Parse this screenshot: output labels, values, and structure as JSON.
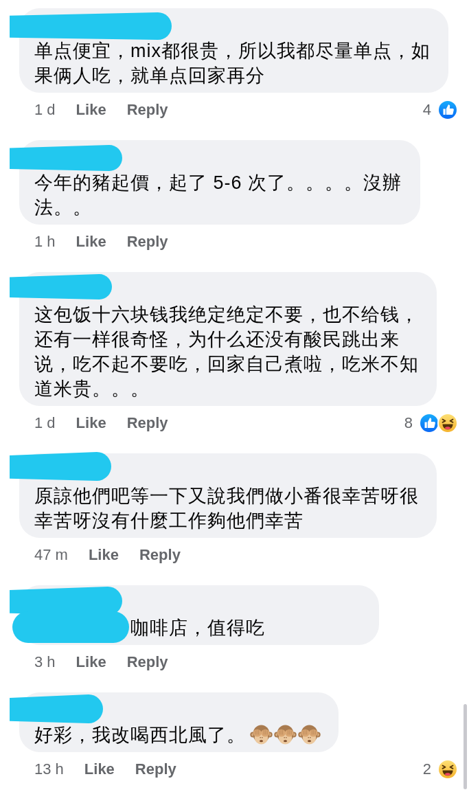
{
  "comments": [
    {
      "kind": "plain",
      "text": "单点便宜，mix都很贵，所以我都尽量单点，如果俩人吃，就单点回家再分",
      "time": "1 d",
      "like": "Like",
      "reply": "Reply",
      "reaction_count": "4",
      "reactions": [
        {
          "kind": "like"
        }
      ]
    },
    {
      "kind": "plain",
      "text": "今年的豬起價，起了 5-6 次了。。。。沒辦法。。",
      "time": "1 h",
      "like": "Like",
      "reply": "Reply"
    },
    {
      "kind": "plain",
      "text": "这包饭十六块钱我绝定绝定不要，也不给钱，还有一样很奇怪，为什么还没有酸民跳出来说，吃不起不要吃，回家自己煮啦，吃米不知道米贵。。。",
      "time": "1 d",
      "like": "Like",
      "reply": "Reply",
      "reaction_count": "8",
      "reactions": [
        {
          "kind": "like"
        },
        {
          "kind": "haha"
        }
      ]
    },
    {
      "kind": "plain",
      "text": "原諒他們吧等一下又說我們做小番很幸苦呀很幸苦呀沒有什麼工作夠他們幸苦",
      "time": "47 m",
      "like": "Like",
      "reply": "Reply"
    },
    {
      "kind": "covered",
      "text": "咖啡店，值得吃",
      "time": "3 h",
      "like": "Like",
      "reply": "Reply"
    },
    {
      "kind": "plain",
      "text": "好彩，我改喝西北風了。",
      "emojis": [
        {
          "kind": "see_no_evil"
        },
        {
          "kind": "see_no_evil"
        },
        {
          "kind": "see_no_evil"
        }
      ],
      "time": "13 h",
      "like": "Like",
      "reply": "Reply",
      "reaction_count": "2",
      "reactions": [
        {
          "kind": "haha"
        }
      ]
    }
  ]
}
